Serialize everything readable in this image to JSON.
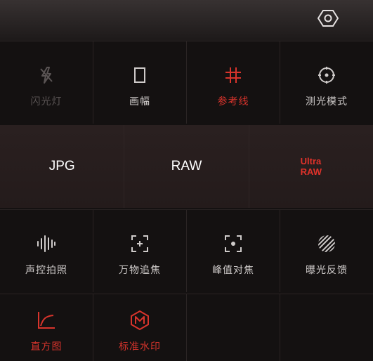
{
  "colors": {
    "accent": "#d8342c",
    "text": "#cfcbca",
    "disabled": "#5a5454",
    "background": "#141111"
  },
  "settings": {
    "icon": "hexagon-gear-icon"
  },
  "row1": [
    {
      "label": "闪光灯",
      "icon": "flash-off-icon",
      "state": "disabled"
    },
    {
      "label": "画幅",
      "icon": "frame-ratio-icon",
      "state": "normal"
    },
    {
      "label": "参考线",
      "icon": "grid-icon",
      "state": "active"
    },
    {
      "label": "测光模式",
      "icon": "metering-icon",
      "state": "normal"
    }
  ],
  "formats": [
    {
      "label": "JPG"
    },
    {
      "label": "RAW"
    },
    {
      "line1": "Ultra",
      "line2": "RAW",
      "state": "active"
    }
  ],
  "row3": [
    {
      "label": "声控拍照",
      "icon": "voice-wave-icon",
      "state": "normal"
    },
    {
      "label": "万物追焦",
      "icon": "focus-track-icon",
      "state": "normal"
    },
    {
      "label": "峰值对焦",
      "icon": "focus-peak-icon",
      "state": "normal"
    },
    {
      "label": "曝光反馈",
      "icon": "exposure-stripes-icon",
      "state": "normal"
    }
  ],
  "row4": [
    {
      "label": "直方图",
      "icon": "histogram-icon",
      "state": "active"
    },
    {
      "label": "标准水印",
      "icon": "watermark-m-icon",
      "state": "active"
    }
  ]
}
